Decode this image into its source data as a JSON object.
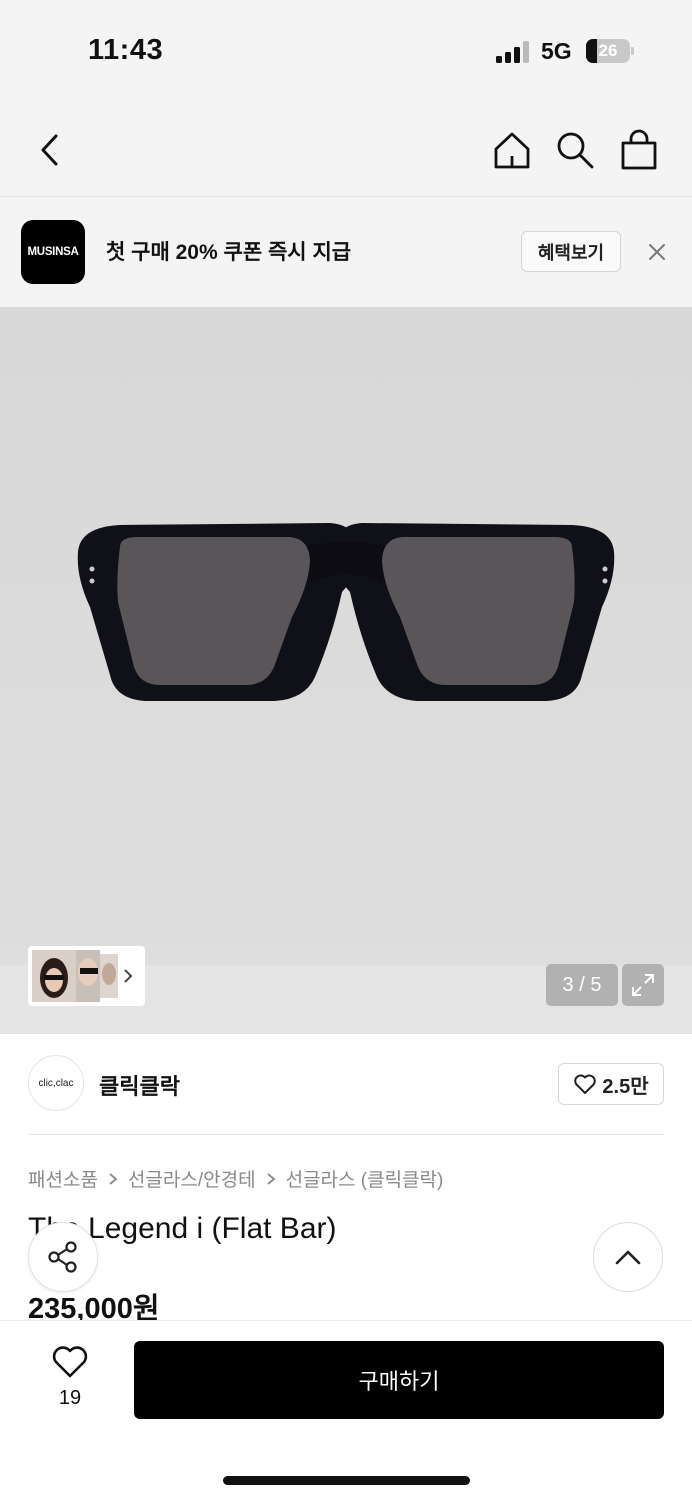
{
  "status_bar": {
    "time": "11:43",
    "network": "5G",
    "battery": "26",
    "battery_level": 0.26
  },
  "nav": {
    "back": "chevron-left-icon",
    "home": "home-icon",
    "search": "search-icon",
    "cart": "shopping-bag-icon"
  },
  "promo": {
    "logo_text": "MUSINSA",
    "text": "첫 구매 20% 쿠폰 즉시 지급",
    "benefit_button": "혜택보기",
    "close": "close-icon"
  },
  "gallery": {
    "counter": "3 / 5"
  },
  "brand": {
    "logo_text": "clic,clac",
    "name": "클릭클락",
    "likes": "2.5만"
  },
  "breadcrumb": [
    "패션소품",
    "선글라스/안경테",
    "선글라스 (클릭클락)"
  ],
  "product": {
    "title": "The Legend i (Flat Bar)",
    "price": "235,000원"
  },
  "bottom": {
    "like_count": "19",
    "buy_label": "구매하기"
  }
}
